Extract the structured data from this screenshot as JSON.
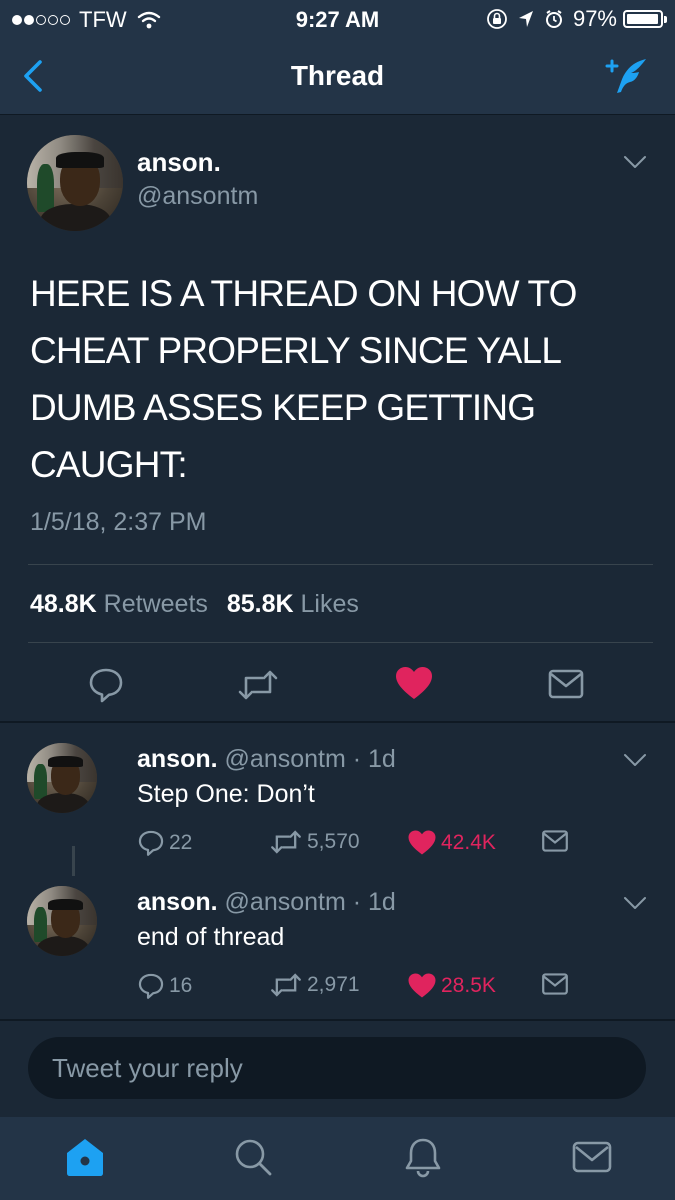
{
  "status_bar": {
    "carrier": "TFW",
    "time": "9:27 AM",
    "battery": "97%",
    "battery_level": 0.97,
    "signal_bars_filled": 2,
    "signal_bars_total": 5
  },
  "nav": {
    "title": "Thread",
    "back_icon": "chevron-left-icon",
    "compose_icon": "compose-tweet-icon"
  },
  "main_tweet": {
    "name": "anson.",
    "handle": "@ansontm",
    "text": "HERE IS A THREAD ON HOW TO CHEAT PROPERLY SINCE YALL DUMB ASSES KEEP GETTING CAUGHT:",
    "date": "1/5/18, 2:37 PM",
    "retweets_count": "48.8K",
    "retweets_label": "Retweets",
    "likes_count": "85.8K",
    "likes_label": "Likes",
    "liked": true
  },
  "replies": [
    {
      "name": "anson.",
      "handle": "@ansontm",
      "time": "· 1d",
      "text": "Step One: Don’t",
      "replies": "22",
      "retweets": "5,570",
      "likes": "42.4K"
    },
    {
      "name": "anson.",
      "handle": "@ansontm",
      "time": "· 1d",
      "text": "end of thread",
      "replies": "16",
      "retweets": "2,971",
      "likes": "28.5K"
    }
  ],
  "composer": {
    "placeholder": "Tweet your reply"
  },
  "tab_bar": {
    "tabs": [
      "home-icon",
      "search-icon",
      "notifications-icon",
      "messages-icon"
    ],
    "active": "home-icon"
  },
  "colors": {
    "background": "#1b2836",
    "bar": "#233447",
    "accent": "#1da1f2",
    "like": "#e0245e",
    "muted": "#8899a6"
  }
}
